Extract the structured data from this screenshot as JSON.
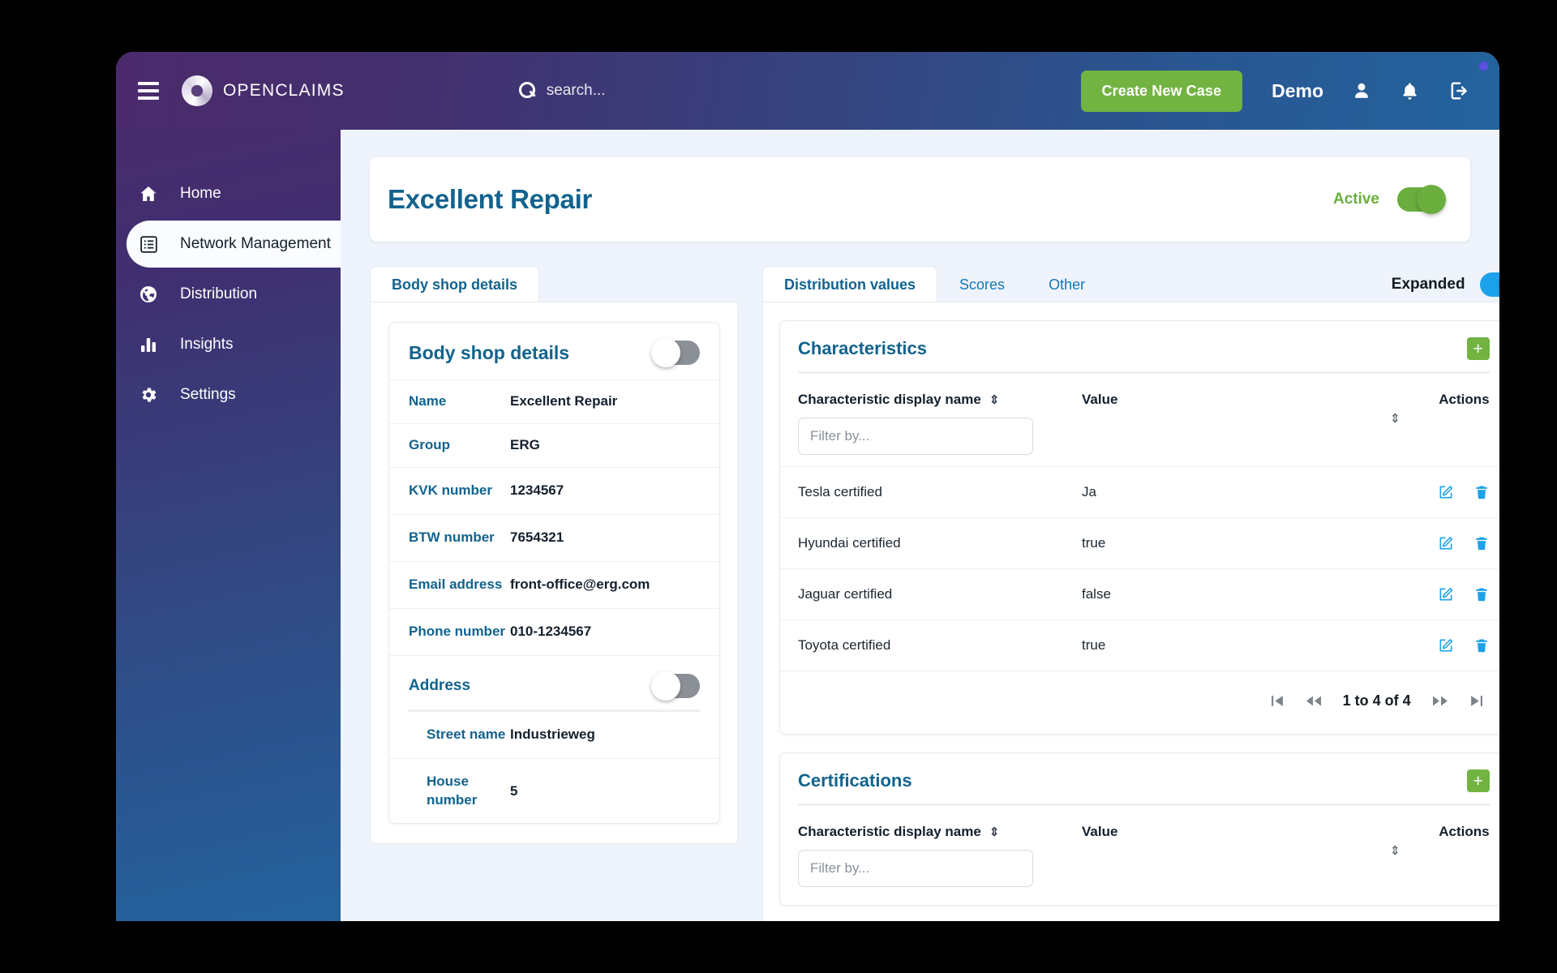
{
  "header": {
    "brand": "OPENCLAIMS",
    "menu_icon": "hamburger-icon",
    "search_placeholder": "search...",
    "create_button": "Create New Case",
    "user_name": "Demo"
  },
  "sidebar": {
    "items": [
      {
        "label": "Home",
        "icon": "home-icon",
        "active": false
      },
      {
        "label": "Network Management",
        "icon": "list-icon",
        "active": true
      },
      {
        "label": "Distribution",
        "icon": "globe-icon",
        "active": false
      },
      {
        "label": "Insights",
        "icon": "bar-chart-icon",
        "active": false
      },
      {
        "label": "Settings",
        "icon": "gear-icon",
        "active": false
      }
    ]
  },
  "page": {
    "title": "Excellent Repair",
    "status_label": "Active",
    "status_on": true
  },
  "left_panel": {
    "tab_label": "Body shop details",
    "card_title": "Body shop details",
    "card_toggle_on": false,
    "fields": [
      {
        "label": "Name",
        "value": "Excellent Repair"
      },
      {
        "label": "Group",
        "value": "ERG"
      },
      {
        "label": "KVK number",
        "value": "1234567"
      },
      {
        "label": "BTW number",
        "value": "7654321"
      },
      {
        "label": "Email address",
        "value": "front-office@erg.com"
      },
      {
        "label": "Phone number",
        "value": "010-1234567"
      }
    ],
    "address": {
      "title": "Address",
      "toggle_on": false,
      "fields": [
        {
          "label": "Street name",
          "value": "Industrieweg"
        },
        {
          "label": "House number",
          "value": "5"
        }
      ]
    }
  },
  "right_panel": {
    "tabs": [
      {
        "label": "Distribution values",
        "active": true
      },
      {
        "label": "Scores",
        "active": false
      },
      {
        "label": "Other",
        "active": false
      }
    ],
    "expanded_label": "Expanded",
    "expanded_on": true,
    "sections": [
      {
        "title": "Characteristics",
        "add_button": "+",
        "columns": [
          "Characteristic display name",
          "Value",
          "Actions"
        ],
        "filter_placeholder": "Filter by...",
        "filter_value": "",
        "rows": [
          {
            "name": "Tesla certified",
            "value": "Ja"
          },
          {
            "name": "Hyundai certified",
            "value": "true"
          },
          {
            "name": "Jaguar certified",
            "value": "false"
          },
          {
            "name": "Toyota certified",
            "value": "true"
          }
        ],
        "pager_text": "1 to 4 of 4"
      },
      {
        "title": "Certifications",
        "add_button": "+",
        "columns": [
          "Characteristic display name",
          "Value",
          "Actions"
        ],
        "filter_placeholder": "Filter by...",
        "filter_value": "",
        "rows": [],
        "pager_text": ""
      }
    ]
  },
  "colors": {
    "purple": "#4b2a6b",
    "blue": "#24639e",
    "green": "#72b342",
    "accent_blue": "#1ca2ea",
    "title_blue": "#12638e"
  }
}
